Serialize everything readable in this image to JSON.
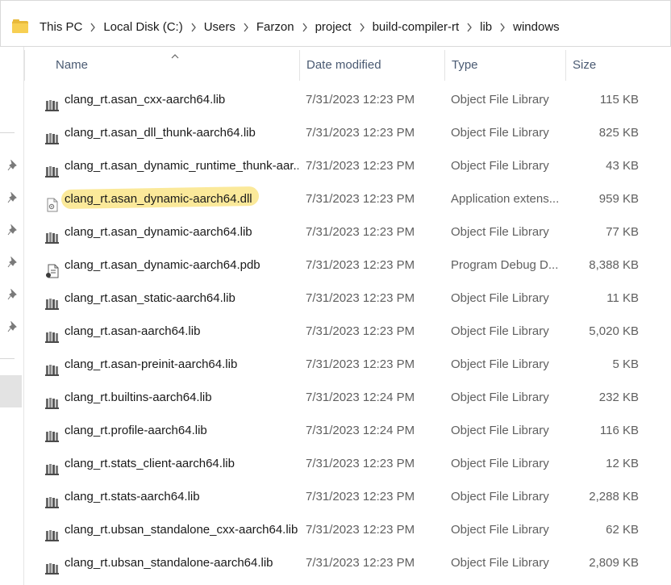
{
  "address_bar": {
    "breadcrumbs": [
      "This PC",
      "Local Disk (C:)",
      "Users",
      "Farzon",
      "project",
      "build-compiler-rt",
      "lib",
      "windows"
    ],
    "folder_icon_color": "#f7cf52"
  },
  "columns": {
    "name": "Name",
    "date_modified": "Date modified",
    "type": "Type",
    "size": "Size"
  },
  "files": [
    {
      "name": "clang_rt.asan_cxx-aarch64.lib",
      "date": "7/31/2023 12:23 PM",
      "type": "Object File Library",
      "size": "115 KB",
      "icon": "lib-icon"
    },
    {
      "name": "clang_rt.asan_dll_thunk-aarch64.lib",
      "date": "7/31/2023 12:23 PM",
      "type": "Object File Library",
      "size": "825 KB",
      "icon": "lib-icon"
    },
    {
      "name": "clang_rt.asan_dynamic_runtime_thunk-aar...",
      "date": "7/31/2023 12:23 PM",
      "type": "Object File Library",
      "size": "43 KB",
      "icon": "lib-icon"
    },
    {
      "name": "clang_rt.asan_dynamic-aarch64.dll",
      "date": "7/31/2023 12:23 PM",
      "type": "Application extens...",
      "size": "959 KB",
      "icon": "dll-icon",
      "highlighted": true
    },
    {
      "name": "clang_rt.asan_dynamic-aarch64.lib",
      "date": "7/31/2023 12:23 PM",
      "type": "Object File Library",
      "size": "77 KB",
      "icon": "lib-icon"
    },
    {
      "name": "clang_rt.asan_dynamic-aarch64.pdb",
      "date": "7/31/2023 12:23 PM",
      "type": "Program Debug D...",
      "size": "8,388 KB",
      "icon": "pdb-icon"
    },
    {
      "name": "clang_rt.asan_static-aarch64.lib",
      "date": "7/31/2023 12:23 PM",
      "type": "Object File Library",
      "size": "11 KB",
      "icon": "lib-icon"
    },
    {
      "name": "clang_rt.asan-aarch64.lib",
      "date": "7/31/2023 12:23 PM",
      "type": "Object File Library",
      "size": "5,020 KB",
      "icon": "lib-icon"
    },
    {
      "name": "clang_rt.asan-preinit-aarch64.lib",
      "date": "7/31/2023 12:23 PM",
      "type": "Object File Library",
      "size": "5 KB",
      "icon": "lib-icon"
    },
    {
      "name": "clang_rt.builtins-aarch64.lib",
      "date": "7/31/2023 12:24 PM",
      "type": "Object File Library",
      "size": "232 KB",
      "icon": "lib-icon"
    },
    {
      "name": "clang_rt.profile-aarch64.lib",
      "date": "7/31/2023 12:24 PM",
      "type": "Object File Library",
      "size": "116 KB",
      "icon": "lib-icon"
    },
    {
      "name": "clang_rt.stats_client-aarch64.lib",
      "date": "7/31/2023 12:23 PM",
      "type": "Object File Library",
      "size": "12 KB",
      "icon": "lib-icon"
    },
    {
      "name": "clang_rt.stats-aarch64.lib",
      "date": "7/31/2023 12:23 PM",
      "type": "Object File Library",
      "size": "2,288 KB",
      "icon": "lib-icon"
    },
    {
      "name": "clang_rt.ubsan_standalone_cxx-aarch64.lib",
      "date": "7/31/2023 12:23 PM",
      "type": "Object File Library",
      "size": "62 KB",
      "icon": "lib-icon"
    },
    {
      "name": "clang_rt.ubsan_standalone-aarch64.lib",
      "date": "7/31/2023 12:23 PM",
      "type": "Object File Library",
      "size": "2,809 KB",
      "icon": "lib-icon"
    }
  ],
  "highlight_color": "#fae278"
}
